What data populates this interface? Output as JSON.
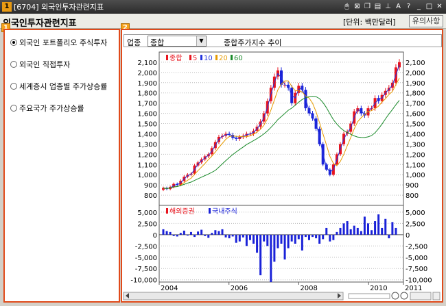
{
  "window": {
    "number": "1",
    "title": "[6704] 외국인투자관련지표",
    "controls": [
      "mouse-icon",
      "grid-icon",
      "copy-icon",
      "print-icon",
      "pin-icon",
      "font-icon",
      "help-icon",
      "minimize-icon",
      "maximize-icon",
      "close-icon"
    ]
  },
  "header": {
    "title": "외국인투자관련지표",
    "unit": "[단위: 백만달러]",
    "notice_button": "유의사항"
  },
  "left_panel": {
    "tag": "1",
    "options": [
      {
        "label": "외국인 포트폴리오 주식투자",
        "selected": true
      },
      {
        "label": "외국인 직접투자",
        "selected": false
      },
      {
        "label": "세계증시 업종별 주가상승률",
        "selected": false
      },
      {
        "label": "주요국가 주가상승률",
        "selected": false
      }
    ]
  },
  "right_panel": {
    "tag": "2",
    "sector_label": "업종",
    "sector_value": "종합",
    "chart_title": "종합주가지수 추이"
  },
  "colors": {
    "up": "#e8141e",
    "down": "#1a22d8",
    "ma5": "#e8141e",
    "ma10": "#2233dd",
    "ma20": "#e69a00",
    "ma60": "#1a8a2a",
    "frame": "#e04a1a"
  },
  "chart_data": [
    {
      "type": "candlestick",
      "legend": [
        {
          "name": "종합",
          "color": "#e8141e"
        },
        {
          "name": "5",
          "color": "#e8141e"
        },
        {
          "name": "10",
          "color": "#2233dd"
        },
        {
          "name": "20",
          "color": "#e69a00"
        },
        {
          "name": "60",
          "color": "#1a8a2a"
        }
      ],
      "y_ticks": [
        2100,
        2000,
        1900,
        1800,
        1700,
        1600,
        1500,
        1400,
        1300,
        1200,
        1100,
        1000,
        900,
        800
      ],
      "y_tick_labels": [
        "2,100",
        "2,000",
        "1,900",
        "1,800",
        "1,700",
        "1,600",
        "1,500",
        "1,400",
        "1,300",
        "1,200",
        "1,100",
        "1,000",
        "900",
        "800"
      ],
      "ylim": [
        700,
        2200
      ],
      "x_range": [
        2004,
        2011
      ],
      "close": [
        870,
        860,
        880,
        910,
        900,
        940,
        980,
        1000,
        1010,
        1090,
        1120,
        1150,
        1180,
        1200,
        1260,
        1320,
        1370,
        1380,
        1400,
        1390,
        1360,
        1350,
        1370,
        1380,
        1400,
        1400,
        1430,
        1470,
        1520,
        1600,
        1720,
        1850,
        1960,
        2020,
        1880,
        1880,
        1850,
        1700,
        1800,
        1870,
        1830,
        1650,
        1600,
        1550,
        1450,
        1300,
        1100,
        1050,
        1000,
        1100,
        1200,
        1300,
        1400,
        1420,
        1500,
        1620,
        1650,
        1600,
        1580,
        1650,
        1650,
        1750,
        1720,
        1780,
        1820,
        1850,
        1900,
        2050,
        2100
      ],
      "ma_period_labels": [
        "5",
        "10",
        "20",
        "60"
      ]
    },
    {
      "type": "bar",
      "legend": [
        {
          "name": "해외증권",
          "color": "#e8141e"
        },
        {
          "name": "국내주식",
          "color": "#1a22d8"
        }
      ],
      "y_ticks": [
        5000,
        2500,
        0,
        -2500,
        -5000,
        -7500,
        -10000
      ],
      "y_tick_labels": [
        "5,000",
        "2,500",
        "0",
        "-2,500",
        "-5,000",
        "-7,500",
        "-10,000"
      ],
      "ylim": [
        -10500,
        6500
      ],
      "domestic": [
        1200,
        800,
        600,
        -300,
        -400,
        400,
        900,
        -200,
        600,
        -500,
        700,
        1100,
        -300,
        -700,
        400,
        1000,
        800,
        1200,
        -600,
        -800,
        -400,
        -1800,
        -1500,
        -600,
        -2500,
        -1200,
        -2000,
        -4000,
        -9000,
        -1500,
        -2500,
        -10500,
        -6000,
        -3000,
        -2000,
        -5500,
        -3000,
        -1500,
        -2000,
        -1000,
        -3500,
        -500,
        -1200,
        -500,
        -800,
        -2000,
        -1000,
        1500,
        -1500,
        -1200,
        600,
        1500,
        2500,
        3000,
        1200,
        2000,
        1500,
        800,
        4000,
        2500,
        1000,
        3000,
        4500,
        1500,
        3500,
        -800,
        2800,
        1500
      ],
      "foreign": [
        0,
        0,
        0,
        0,
        0,
        0,
        0,
        0,
        0,
        0,
        0,
        0,
        0,
        0,
        0,
        0,
        0,
        0,
        0,
        0,
        0,
        0,
        0,
        0,
        0,
        0,
        0,
        0,
        0,
        0,
        0,
        0,
        0,
        0,
        0,
        0,
        0,
        0,
        0,
        0,
        0,
        0,
        0,
        0,
        0,
        0,
        0,
        0,
        0,
        0,
        0,
        0,
        0,
        0,
        0,
        0,
        0,
        0,
        0,
        0,
        0,
        0,
        0,
        0,
        0,
        0,
        0,
        0
      ],
      "x_tick_labels": [
        "2004",
        "2006",
        "2008",
        "2010",
        "2011"
      ],
      "x_tick_values": [
        2004,
        2006,
        2008,
        2010,
        2011
      ]
    }
  ]
}
